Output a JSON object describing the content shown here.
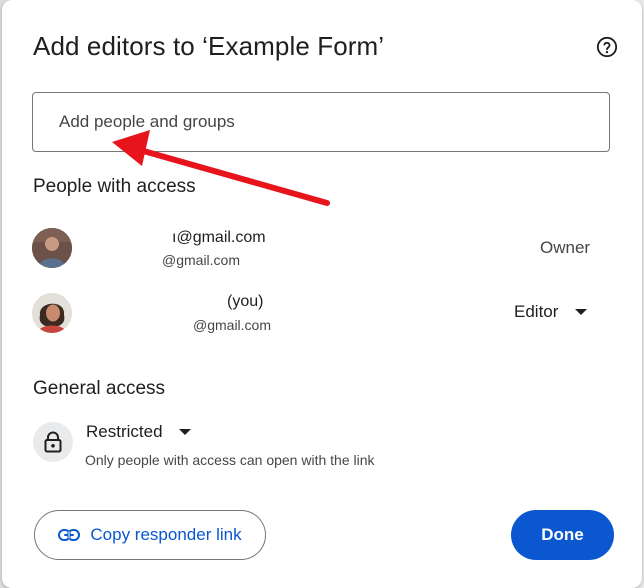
{
  "dialog": {
    "title": "Add editors to ‘Example Form’",
    "help_icon": "help-circle-icon"
  },
  "add_people": {
    "placeholder": "Add people and groups"
  },
  "annotation": {
    "color": "#e8141c"
  },
  "people_section": {
    "title": "People with access",
    "people": [
      {
        "name": "ı@gmail.com",
        "email": "@gmail.com",
        "role": "Owner"
      },
      {
        "name": "(you)",
        "email": "@gmail.com",
        "role": "Editor"
      }
    ]
  },
  "general_access": {
    "title": "General access",
    "icon": "lock-icon",
    "setting": "Restricted",
    "description": "Only people with access can open with the link"
  },
  "footer": {
    "copy_link_label": "Copy responder link",
    "copy_link_icon": "link-icon",
    "done_label": "Done"
  },
  "colors": {
    "accent": "#0b57d0",
    "text_primary": "#1f1f1f",
    "text_secondary": "#444746",
    "border": "#747775"
  }
}
